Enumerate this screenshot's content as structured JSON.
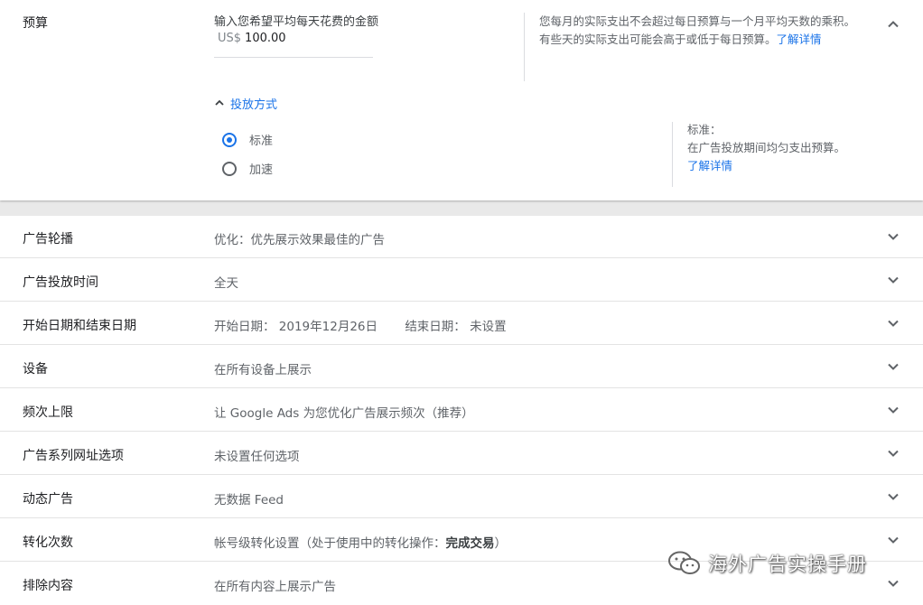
{
  "budget": {
    "title": "预算",
    "input_label": "输入您希望平均每天花费的金额",
    "currency": "US$",
    "amount": "100.00",
    "help_line1": "您每月的实际支出不会超过每日预算与一个月平均天数的乘积。",
    "help_line2": "有些天的实际支出可能会高于或低于每日预算。",
    "help_link": "了解详情",
    "collapse_icon": "chevron-up-icon",
    "delivery": {
      "toggle_label": "投放方式",
      "options": [
        {
          "label": "标准",
          "selected": true
        },
        {
          "label": "加速",
          "selected": false
        }
      ],
      "help_title": "标准：",
      "help_text": "在广告投放期间均匀支出预算。",
      "help_link": "了解详情"
    }
  },
  "settings": [
    {
      "title": "广告轮播",
      "value": "优化：优先展示效果最佳的广告"
    },
    {
      "title": "广告投放时间",
      "value": "全天"
    },
    {
      "title": "开始日期和结束日期",
      "value": "开始日期： 2019年12月26日",
      "value2": "结束日期： 未设置"
    },
    {
      "title": "设备",
      "value": "在所有设备上展示"
    },
    {
      "title": "频次上限",
      "value": "让 Google Ads 为您优化广告展示频次（推荐）"
    },
    {
      "title": "广告系列网址选项",
      "value": "未设置任何选项"
    },
    {
      "title": "动态广告",
      "value": "无数据 Feed"
    },
    {
      "title": "转化次数",
      "value": "帐号级转化设置（处于使用中的转化操作：",
      "value_bold": "完成交易",
      "value_end": "）"
    },
    {
      "title": "排除内容",
      "value": "在所有内容上展示广告"
    }
  ],
  "watermark": {
    "text": "海外广告实操手册",
    "icon": "wechat-icon"
  },
  "colors": {
    "accent": "#1a73e8",
    "text": "#202124",
    "muted": "#5f6368"
  }
}
